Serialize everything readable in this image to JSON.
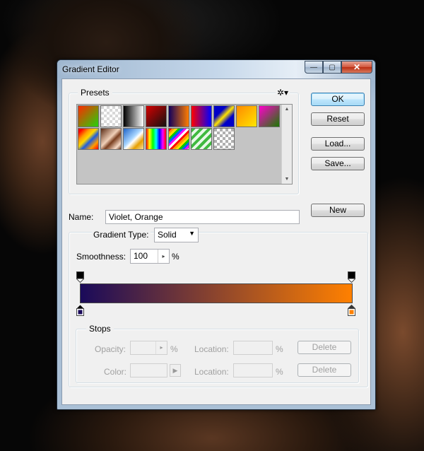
{
  "window": {
    "title": "Gradient Editor"
  },
  "caption_buttons": {
    "minimize": "—",
    "maximize": "▢",
    "close": "✕"
  },
  "presets": {
    "label": "Presets",
    "menu_icon": "gear-icon",
    "swatches": [
      "linear-gradient(135deg,#ff2a00,#23d40a)",
      "repeating-conic-gradient(#ffffff 0 25%,#d8d8d8 0 50%) 0 0/8px 8px",
      "linear-gradient(90deg,#000,#fff)",
      "linear-gradient(135deg,#d40000,#111)",
      "linear-gradient(90deg,#12005c,#ff7c00)",
      "linear-gradient(90deg,#ff0000,#0000ff)",
      "linear-gradient(135deg,#0000c8 0 30%,#ffe400 50%,#0000c8 70%)",
      "linear-gradient(135deg,#ff8a00,#ffe600)",
      "linear-gradient(135deg,#ff00cc,#1a7a00)",
      "linear-gradient(135deg,#ff0000 0 10%,#ff9e00 30%,#ffd800 45%,#1b5de3 60%,#ff9e00 80%,#ff0000)",
      "linear-gradient(135deg,#5a2a14,#f0d0b8 45%,#7a3f20 60%,#f8dcc8 85%,#5a2a14)",
      "linear-gradient(135deg,#1e63c8,#a9d6ff 45%,#fff 55%,#e7a000 75%,#f5e0a0)",
      "linear-gradient(90deg,#ff0000,#ffff00,#00ff00,#00ffff,#0000ff,#ff00ff,#ff0000)",
      "repeating-linear-gradient(135deg,#ff0000 0 3px,#ff9e00 3px 6px,#ffe000 6px 9px,#00c800 9px 12px,#0060ff 12px 15px,#ff00ff 15px 18px,#fff 18px 21px)",
      "repeating-linear-gradient(135deg,#3fb93f 0 4px,#e8f8e8 4px 8px)",
      "repeating-conic-gradient(#ffffff 0 25%,#b0b0b0 0 50%) 0 0/8px 8px"
    ]
  },
  "buttons": {
    "ok": "OK",
    "reset": "Reset",
    "load": "Load...",
    "save": "Save...",
    "new": "New"
  },
  "name": {
    "label": "Name:",
    "value": "Violet, Orange"
  },
  "gradient": {
    "type_label": "Gradient Type:",
    "type_value": "Solid",
    "smoothness_label": "Smoothness:",
    "smoothness_value": "100",
    "smoothness_unit": "%",
    "start_color": "#1a0a5a",
    "end_color": "#ff8000"
  },
  "stops": {
    "label": "Stops",
    "opacity_label": "Opacity:",
    "opacity_unit": "%",
    "color_label": "Color:",
    "location_label": "Location:",
    "location_unit": "%",
    "delete_label": "Delete"
  }
}
